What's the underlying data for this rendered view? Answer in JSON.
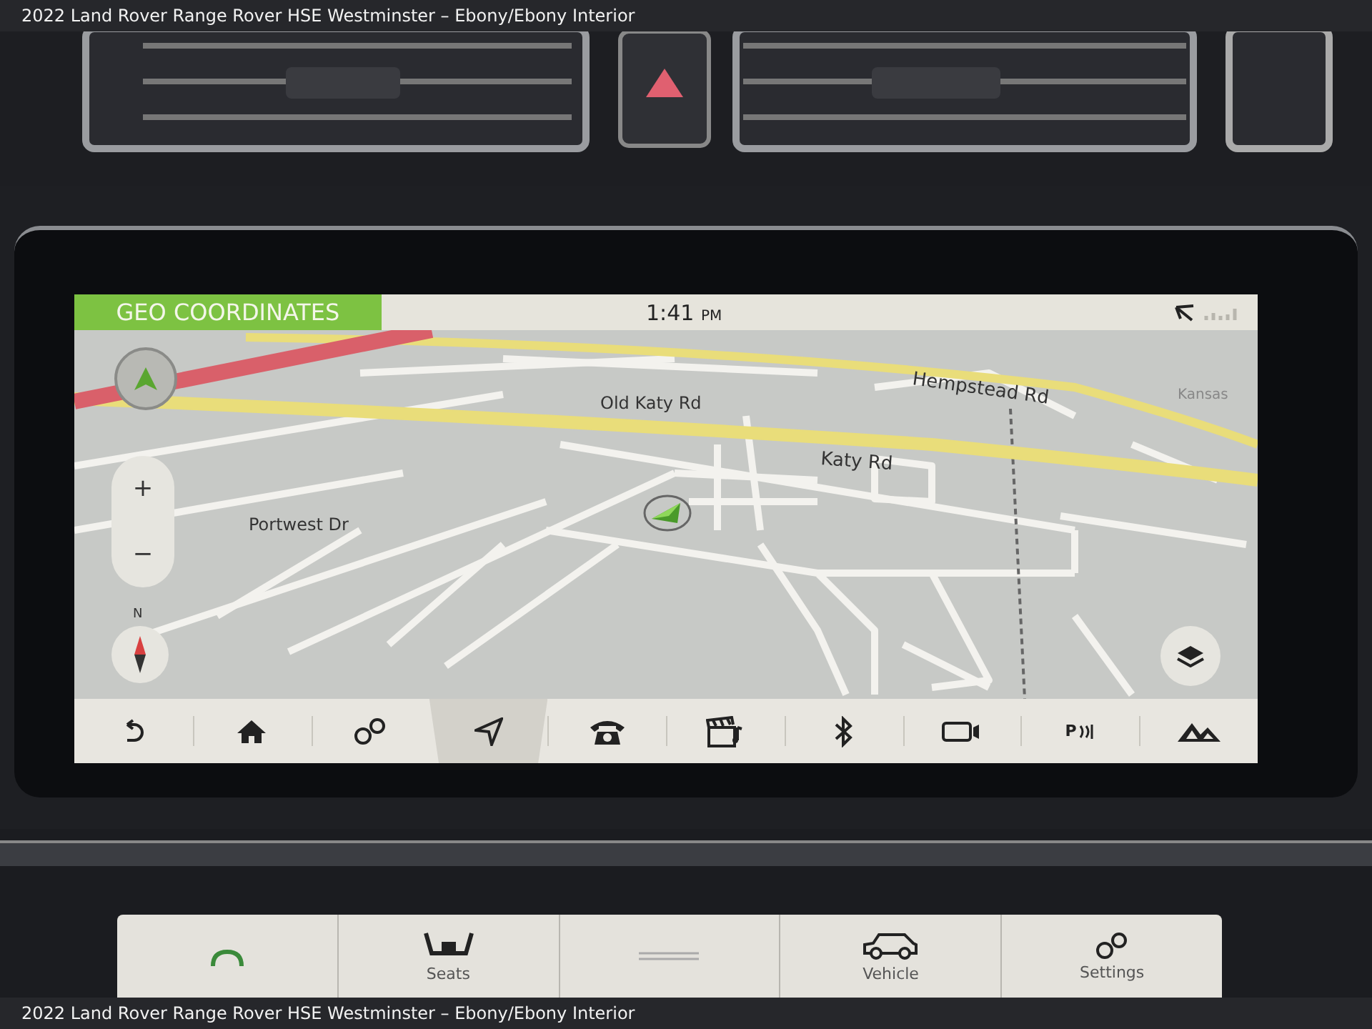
{
  "caption_top": "2022 Land Rover Range Rover HSE Westminster – Ebony/Ebony Interior",
  "screen": {
    "mode_label": "GEO COORDINATES",
    "time": "1:41",
    "time_suffix": "PM"
  },
  "map": {
    "road_labels": [
      {
        "kind": "major",
        "text": "Hempstead Rd"
      },
      {
        "kind": "minor",
        "text": "Old Katy Rd"
      },
      {
        "kind": "major",
        "text": "Katy Rd"
      },
      {
        "kind": "minor",
        "text": "Portwest Dr"
      },
      {
        "kind": "edge",
        "text": "Kansas"
      }
    ],
    "zoom_in": "+",
    "zoom_out": "−",
    "compass_label": "N"
  },
  "nav_bar": [
    {
      "kind": "back",
      "selected": false
    },
    {
      "kind": "home",
      "selected": false
    },
    {
      "kind": "apps",
      "selected": false
    },
    {
      "kind": "navigation",
      "selected": true
    },
    {
      "kind": "phone",
      "selected": false
    },
    {
      "kind": "media",
      "selected": false
    },
    {
      "kind": "bluetooth",
      "selected": false
    },
    {
      "kind": "camera",
      "selected": false
    },
    {
      "kind": "parking",
      "glyph": "P",
      "selected": false
    },
    {
      "kind": "terrain",
      "selected": false
    }
  ],
  "lower_panel": [
    {
      "kind": "climate"
    },
    {
      "kind": "seats",
      "label": "Seats"
    },
    {
      "kind": "blank"
    },
    {
      "kind": "vehicle",
      "label": "Vehicle"
    },
    {
      "kind": "settings",
      "label": "Settings"
    }
  ],
  "caption_bottom": "2022 Land Rover Range Rover HSE Westminster – Ebony/Ebony Interior"
}
